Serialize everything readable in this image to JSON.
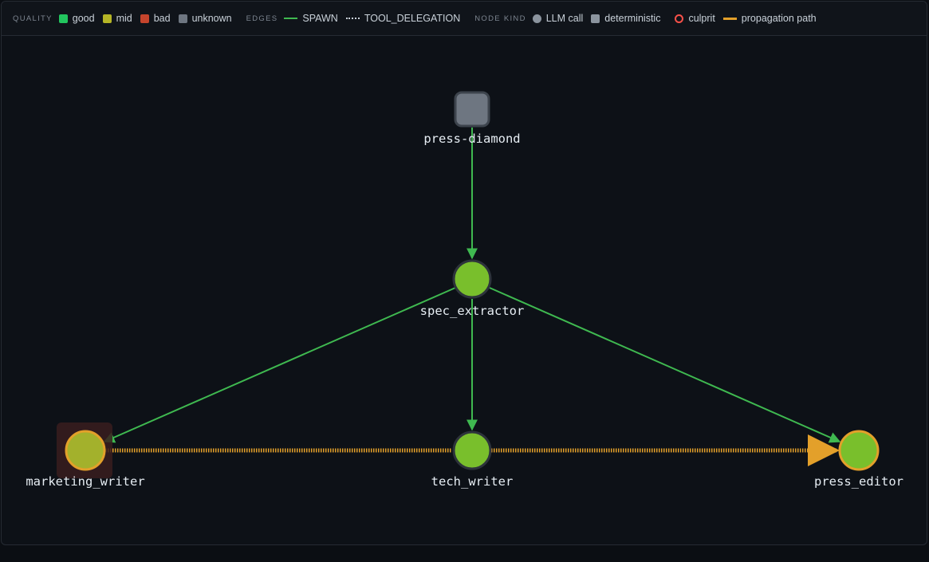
{
  "legend": {
    "quality": {
      "label": "QUALITY",
      "items": [
        {
          "label": "good",
          "color": "#22c55e"
        },
        {
          "label": "mid",
          "color": "#b5b526"
        },
        {
          "label": "bad",
          "color": "#c5442c"
        },
        {
          "label": "unknown",
          "color": "#6e7681"
        }
      ]
    },
    "edges": {
      "label": "EDGES",
      "items": [
        {
          "label": "SPAWN",
          "color": "#3fb950",
          "style": "solid"
        },
        {
          "label": "TOOL_DELEGATION",
          "color": "#c9d1d9",
          "style": "dotted"
        }
      ]
    },
    "node_kind": {
      "label": "NODE KIND",
      "items": [
        {
          "label": "LLM call",
          "shape": "circle",
          "color": "#8b949e"
        },
        {
          "label": "deterministic",
          "shape": "square",
          "color": "#8b949e"
        }
      ]
    },
    "culprit": {
      "label": "culprit",
      "color": "#f85149"
    },
    "propagation": {
      "label": "propagation path",
      "color": "#e3a02a"
    }
  },
  "graph": {
    "nodes": [
      {
        "id": "press-diamond",
        "label": "press-diamond",
        "kind": "deterministic",
        "quality": "unknown",
        "culprit": false
      },
      {
        "id": "spec_extractor",
        "label": "spec_extractor",
        "kind": "llm",
        "quality": "good",
        "culprit": false
      },
      {
        "id": "marketing_writer",
        "label": "marketing_writer",
        "kind": "llm",
        "quality": "mid",
        "culprit": true
      },
      {
        "id": "tech_writer",
        "label": "tech_writer",
        "kind": "llm",
        "quality": "good",
        "culprit": false
      },
      {
        "id": "press_editor",
        "label": "press_editor",
        "kind": "llm",
        "quality": "good",
        "culprit": false
      }
    ],
    "edges": [
      {
        "from": "press-diamond",
        "to": "spec_extractor",
        "type": "SPAWN"
      },
      {
        "from": "spec_extractor",
        "to": "marketing_writer",
        "type": "SPAWN"
      },
      {
        "from": "spec_extractor",
        "to": "tech_writer",
        "type": "SPAWN"
      },
      {
        "from": "spec_extractor",
        "to": "press_editor",
        "type": "SPAWN"
      }
    ],
    "propagation_path": [
      "marketing_writer",
      "tech_writer",
      "press_editor"
    ]
  }
}
